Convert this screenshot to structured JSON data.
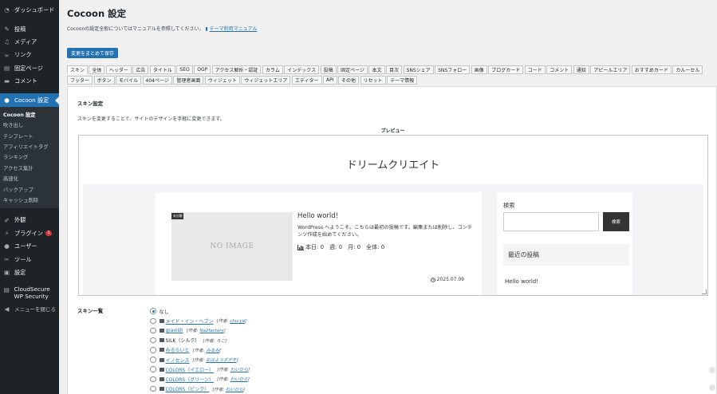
{
  "sidebar": {
    "items_top": [
      {
        "label": "ダッシュボード",
        "icon": "dashboard-icon",
        "glyph": "◔"
      }
    ],
    "items_main": [
      {
        "label": "投稿",
        "icon": "pin-icon",
        "glyph": "✎"
      },
      {
        "label": "メディア",
        "icon": "media-icon",
        "glyph": "♫"
      },
      {
        "label": "リンク",
        "icon": "link-icon",
        "glyph": "∞"
      },
      {
        "label": "固定ページ",
        "icon": "page-icon",
        "glyph": "▤"
      },
      {
        "label": "コメント",
        "icon": "comment-icon",
        "glyph": "▬"
      }
    ],
    "active": {
      "label": "Cocoon 設定",
      "icon": "cocoon-icon",
      "glyph": "●"
    },
    "submenu": [
      {
        "label": "Cocoon 設定",
        "current": true
      },
      {
        "label": "吹き出し"
      },
      {
        "label": "テンプレート"
      },
      {
        "label": "アフィリエイトタグ"
      },
      {
        "label": "ランキング"
      },
      {
        "label": "アクセス集計"
      },
      {
        "label": "高速化"
      },
      {
        "label": "バックアップ"
      },
      {
        "label": "キャッシュ削除"
      }
    ],
    "items_bottom": [
      {
        "label": "外観",
        "icon": "appearance-icon",
        "glyph": "✐"
      },
      {
        "label": "プラグイン",
        "icon": "plugin-icon",
        "glyph": "⚡",
        "badge": "1"
      },
      {
        "label": "ユーザー",
        "icon": "user-icon",
        "glyph": "●"
      },
      {
        "label": "ツール",
        "icon": "tool-icon",
        "glyph": "✂"
      },
      {
        "label": "設定",
        "icon": "settings-icon",
        "glyph": "▣"
      }
    ],
    "cloudsecure": {
      "label": "CloudSecure WP Security",
      "icon": "cloudsecure-icon",
      "glyph": "▤"
    },
    "collapse": {
      "label": "メニューを閉じる",
      "icon": "collapse-icon",
      "glyph": "◀"
    }
  },
  "page": {
    "title": "Cocoon 設定",
    "notice_text": "Cocoonの設定全般についてはマニュアルを参照してください。",
    "notice_link": "テーマ利用マニュアル",
    "save_button": "変更をまとめて保存"
  },
  "tabs": [
    "スキン",
    "全体",
    "ヘッダー",
    "広告",
    "タイトル",
    "SEO",
    "OGP",
    "アクセス解析・認証",
    "カラム",
    "インデックス",
    "投稿",
    "固定ページ",
    "本文",
    "目次",
    "SNSシェア",
    "SNSフォロー",
    "画像",
    "ブログカード",
    "コード",
    "コメント",
    "通知",
    "アピールエリア",
    "おすすめカード",
    "カルーセル",
    "フッター",
    "ボタン",
    "モバイル",
    "404ページ",
    "管理者画面",
    "ウィジェット",
    "ウィジェットエリア",
    "エディター",
    "API",
    "その他",
    "リセット",
    "テーマ情報"
  ],
  "active_tab_index": 0,
  "skin_section": {
    "title": "スキン設定",
    "description": "スキンを変更することで、サイトのデザインを手軽に変更できます。",
    "preview_label": "プレビュー"
  },
  "preview": {
    "site_title": "ドリームクリエイト",
    "category": "未分類",
    "no_image": "NO IMAGE",
    "post_title": "Hello world!",
    "post_excerpt": "WordPress へようこそ。こちらは最初の投稿です。編集または削除し、コンテンツ作成を始めてください。",
    "stats": "本日: 0　週: 0　月: 0　全体: 0",
    "date": "2025.07.09",
    "search_label": "検索",
    "search_button": "検索",
    "recent_posts": "最近の投稿",
    "recent_item": "Hello world!"
  },
  "skin_list": {
    "title": "スキン一覧",
    "items": [
      {
        "name": "なし",
        "checked": true,
        "plain": true,
        "no_icon": true
      },
      {
        "name": "メイド・イン・ヘブン",
        "author_label": "[作者: ",
        "author": "chu-ya",
        "author_end": "]"
      },
      {
        "name": "gravish",
        "author_label": "[作者: ",
        "author": "Na2factory",
        "author_end": "]"
      },
      {
        "name": "SILK（シルク）",
        "plain": true,
        "author_label": "[作者: ",
        "author": "ろこ",
        "author_end": "]",
        "author_plain": true
      },
      {
        "name": "みるらいと",
        "author_label": "[作者: ",
        "author": "みるみ",
        "author_end": "]"
      },
      {
        "name": "イノセンス",
        "author_label": "[作者: ",
        "author": "おはようボデチ",
        "author_end": "]"
      },
      {
        "name": "COLORS（イエロー）",
        "author_label": "[作者: ",
        "author": "わいひら",
        "author_end": "]"
      },
      {
        "name": "COLORS（グリーン）",
        "author_label": "[作者: ",
        "author": "わいひら",
        "author_end": "]"
      },
      {
        "name": "COLORS（ピンク）",
        "author_label": "[作者: ",
        "author": "わいひら",
        "author_end": "]"
      }
    ]
  },
  "colors": {
    "sidebar_bg": "#1d2327",
    "accent": "#2271b1",
    "badge": "#d63638"
  }
}
